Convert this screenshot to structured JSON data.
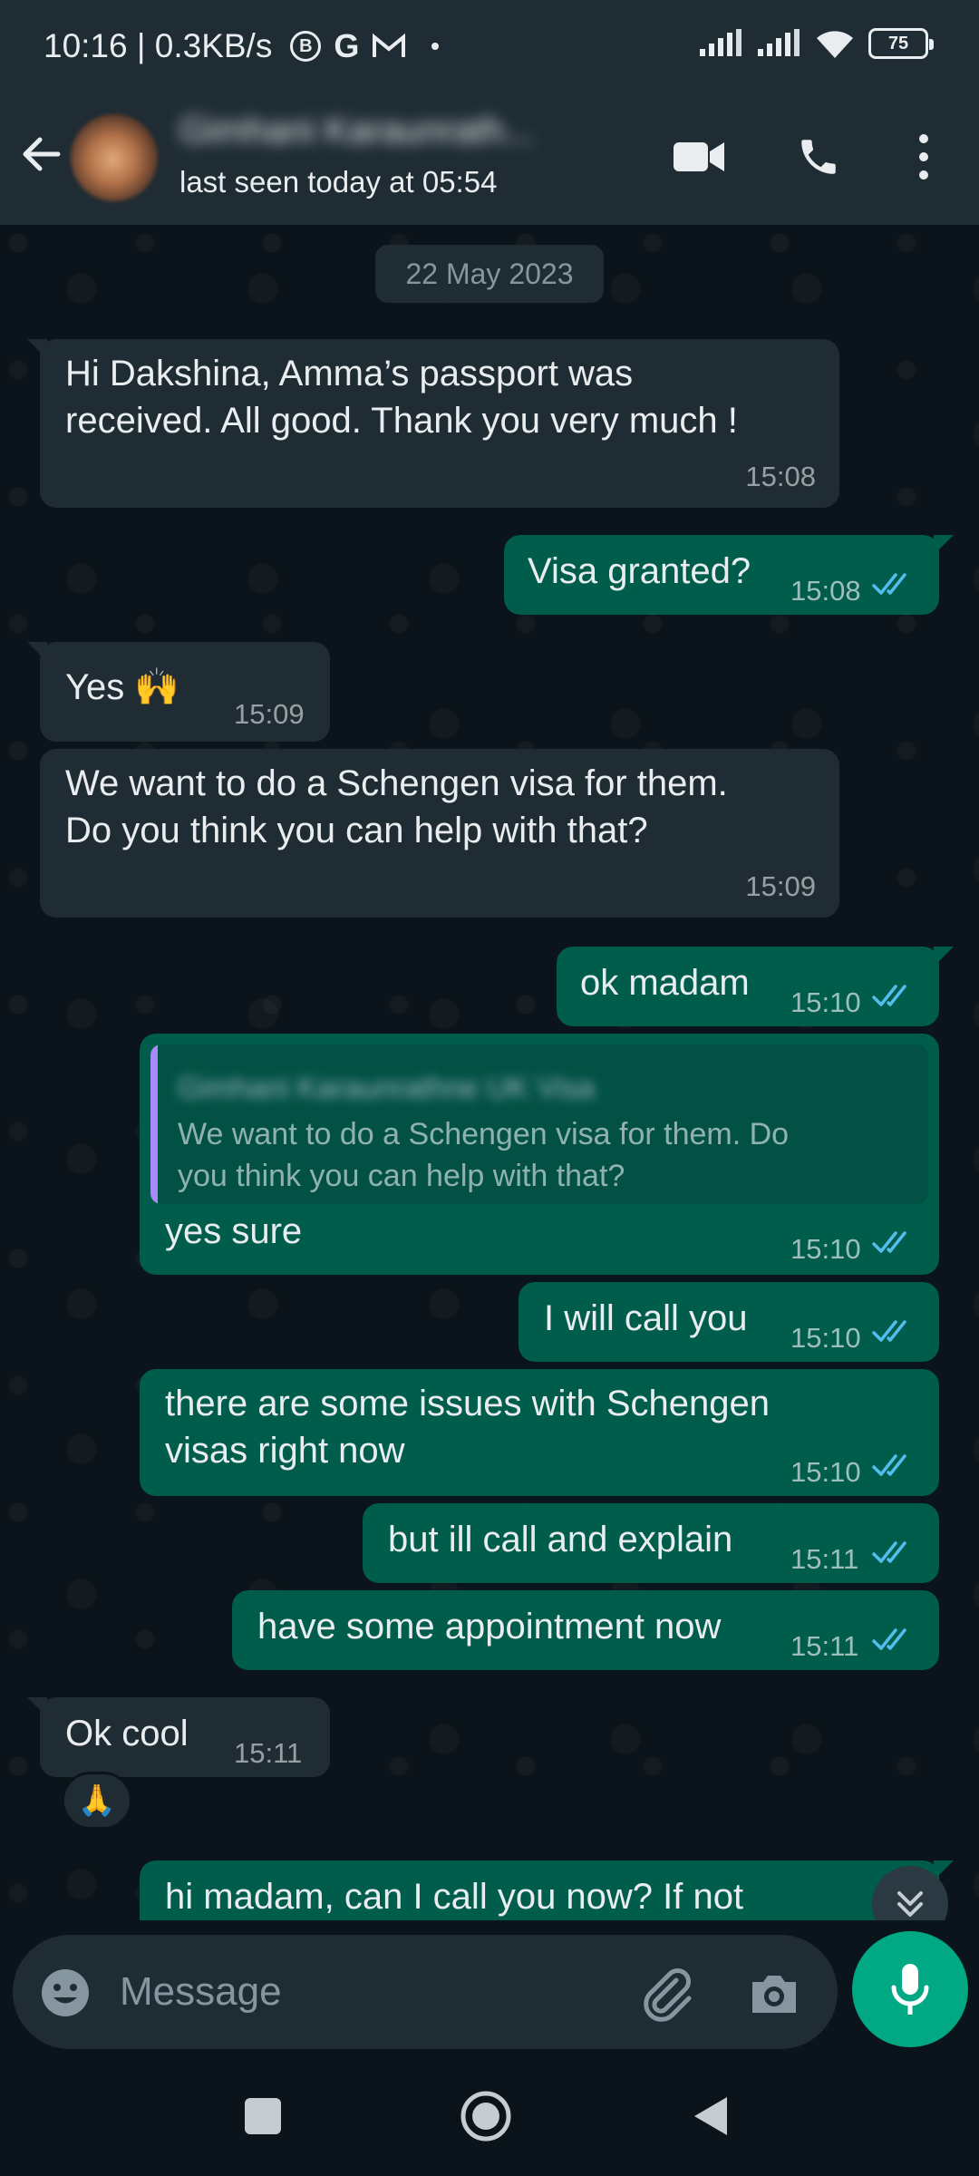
{
  "status_bar": {
    "time_speed": "10:16 | 0.3KB/s",
    "battery": "75",
    "icons": [
      "b-circle-icon",
      "google-icon",
      "gmail-icon",
      "dot-icon",
      "signal-icon",
      "signal-icon",
      "wifi-icon",
      "battery-icon"
    ]
  },
  "header": {
    "contact_name": "Gimhani Karaunrath...",
    "last_seen": "last seen today at 05:54",
    "icons": [
      "back-arrow-icon",
      "video-call-icon",
      "phone-icon",
      "more-vert-icon"
    ]
  },
  "date_chip": "22 May 2023",
  "messages": [
    {
      "dir": "in",
      "lines": [
        "Hi Dakshina, Amma’s passport was",
        "received. All good. Thank you very much !"
      ],
      "time": "15:08"
    },
    {
      "dir": "out",
      "lines": [
        "Visa granted?"
      ],
      "time": "15:08"
    },
    {
      "dir": "in",
      "lines": [
        "Yes 🙌"
      ],
      "time": "15:09"
    },
    {
      "dir": "in",
      "lines": [
        "We want to do a Schengen visa for them.",
        "Do you think   you can help with that?"
      ],
      "time": "15:09"
    },
    {
      "dir": "out",
      "lines": [
        "ok madam"
      ],
      "time": "15:10"
    },
    {
      "dir": "out",
      "quote": {
        "name": "Gimhani Karaunrathne UK Visa",
        "lines": [
          "We want to do a Schengen visa for them. Do",
          "you think   you can help with that?"
        ]
      },
      "lines": [
        "yes sure"
      ],
      "time": "15:10"
    },
    {
      "dir": "out",
      "lines": [
        "I will call you"
      ],
      "time": "15:10"
    },
    {
      "dir": "out",
      "lines": [
        "there are some issues with Schengen",
        "visas right now"
      ],
      "time": "15:10"
    },
    {
      "dir": "out",
      "lines": [
        "but ill call and explain"
      ],
      "time": "15:11"
    },
    {
      "dir": "out",
      "lines": [
        "have some appointment now"
      ],
      "time": "15:11"
    },
    {
      "dir": "in",
      "lines": [
        "Ok cool"
      ],
      "time": "15:11",
      "reaction": "🙏"
    },
    {
      "dir": "out",
      "lines": [
        "hi madam, can I call you now? If not"
      ],
      "time": ""
    }
  ],
  "input": {
    "placeholder": "Message",
    "icons": [
      "emoji-icon",
      "attach-icon",
      "camera-icon",
      "mic-icon"
    ]
  },
  "colors": {
    "background": "#0b141a",
    "header": "#1f2c34",
    "incoming_bubble": "#202c33",
    "outgoing_bubble": "#005c4b",
    "accent": "#00a884",
    "read_ticks": "#53bdeb"
  },
  "navigation": {
    "icons": [
      "recents-square-icon",
      "home-circle-icon",
      "back-triangle-icon"
    ]
  }
}
